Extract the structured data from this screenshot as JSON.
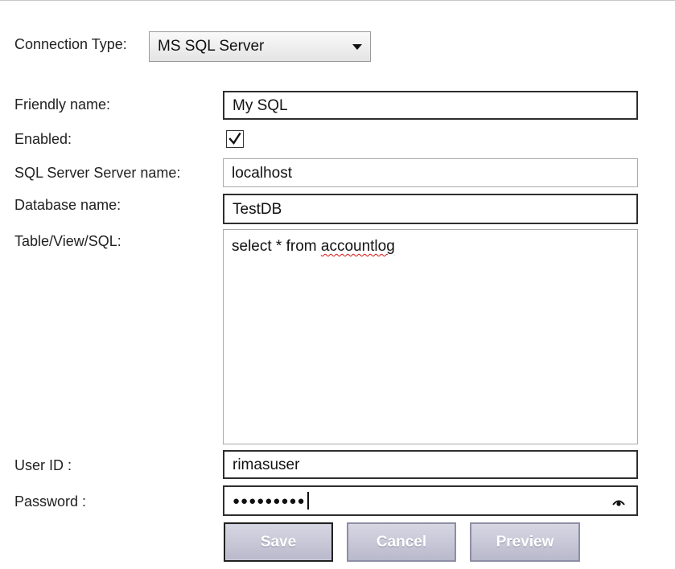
{
  "connection_type": {
    "label": "Connection Type:",
    "value": "MS SQL Server"
  },
  "form": {
    "friendly_name": {
      "label": "Friendly name:",
      "value": "My SQL"
    },
    "enabled": {
      "label": "Enabled:",
      "checked": true
    },
    "server_name": {
      "label": "SQL Server Server name:",
      "value": "localhost"
    },
    "database_name": {
      "label": "Database name:",
      "value": "TestDB"
    },
    "table_sql": {
      "label": "Table/View/SQL:",
      "value_prefix": "select * from ",
      "value_misspelled": "accountlog"
    },
    "user_id": {
      "label": "User ID :",
      "value": "rimasuser"
    },
    "password": {
      "label": "Password :",
      "masked": "●●●●●●●●●"
    }
  },
  "buttons": {
    "save": "Save",
    "cancel": "Cancel",
    "preview": "Preview"
  },
  "icons": {
    "dropdown": "chevron-down-icon",
    "check": "check-icon",
    "reveal": "eye-icon"
  }
}
